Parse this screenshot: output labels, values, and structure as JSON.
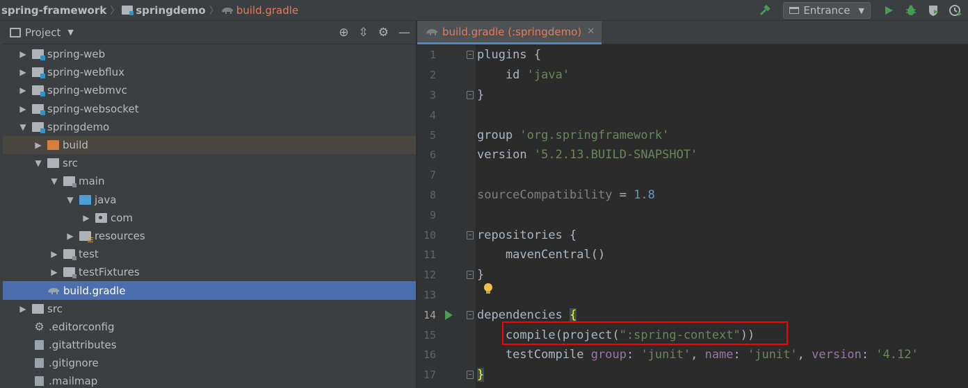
{
  "breadcrumbs": [
    "spring-framework",
    "springdemo",
    "build.gradle"
  ],
  "toolbar": {
    "run_config": "Entrance",
    "build_icon": "hammer-icon",
    "run_icon": "run-icon",
    "debug_icon": "debug-icon",
    "coverage_icon": "coverage-icon",
    "profile_icon": "profile-icon"
  },
  "project_panel": {
    "title": "Project",
    "tree": [
      {
        "label": "spring-web",
        "depth": 0,
        "expanded": false,
        "icon": "module-folder-icon"
      },
      {
        "label": "spring-webflux",
        "depth": 0,
        "expanded": false,
        "icon": "module-folder-icon"
      },
      {
        "label": "spring-webmvc",
        "depth": 0,
        "expanded": false,
        "icon": "module-folder-icon"
      },
      {
        "label": "spring-websocket",
        "depth": 0,
        "expanded": false,
        "icon": "module-folder-icon"
      },
      {
        "label": "springdemo",
        "depth": 0,
        "expanded": true,
        "icon": "module-folder-icon"
      },
      {
        "label": "build",
        "depth": 1,
        "expanded": false,
        "icon": "excluded-folder-icon"
      },
      {
        "label": "src",
        "depth": 1,
        "expanded": true,
        "icon": "folder-icon"
      },
      {
        "label": "main",
        "depth": 2,
        "expanded": true,
        "icon": "source-set-folder-icon"
      },
      {
        "label": "java",
        "depth": 3,
        "expanded": true,
        "icon": "source-root-icon"
      },
      {
        "label": "com",
        "depth": 4,
        "expanded": false,
        "icon": "package-icon"
      },
      {
        "label": "resources",
        "depth": 3,
        "expanded": false,
        "icon": "resources-folder-icon"
      },
      {
        "label": "test",
        "depth": 2,
        "expanded": false,
        "icon": "source-set-folder-icon"
      },
      {
        "label": "testFixtures",
        "depth": 2,
        "expanded": false,
        "icon": "source-set-folder-icon"
      },
      {
        "label": "build.gradle",
        "depth": 1,
        "expanded": null,
        "icon": "gradle-file-icon"
      },
      {
        "label": "src",
        "depth": 0,
        "expanded": false,
        "icon": "folder-icon"
      },
      {
        "label": ".editorconfig",
        "depth": 0,
        "expanded": null,
        "icon": "gear-icon"
      },
      {
        "label": ".gitattributes",
        "depth": 0,
        "expanded": null,
        "icon": "file-icon"
      },
      {
        "label": ".gitignore",
        "depth": 0,
        "expanded": null,
        "icon": "file-icon"
      },
      {
        "label": ".mailmap",
        "depth": 0,
        "expanded": null,
        "icon": "file-icon"
      }
    ]
  },
  "editor": {
    "tab_label": "build.gradle (:springdemo)",
    "current_line": 14,
    "lines": [
      {
        "n": "1",
        "parts": [
          [
            "plugins {",
            "kw"
          ]
        ]
      },
      {
        "n": "2",
        "parts": [
          [
            "    id ",
            "kw"
          ],
          [
            "'java'",
            "str"
          ]
        ]
      },
      {
        "n": "3",
        "parts": [
          [
            "}",
            "kw"
          ]
        ]
      },
      {
        "n": "4",
        "parts": []
      },
      {
        "n": "5",
        "parts": [
          [
            "group ",
            "kw"
          ],
          [
            "'org.springframework'",
            "str"
          ]
        ]
      },
      {
        "n": "6",
        "parts": [
          [
            "version ",
            "kw"
          ],
          [
            "'5.2.13.BUILD-SNAPSHOT'",
            "str"
          ]
        ]
      },
      {
        "n": "7",
        "parts": []
      },
      {
        "n": "8",
        "parts": [
          [
            "sourceCompatibility",
            "dim"
          ],
          [
            " = ",
            "kw"
          ],
          [
            "1.8",
            "num-lit"
          ]
        ]
      },
      {
        "n": "9",
        "parts": []
      },
      {
        "n": "10",
        "parts": [
          [
            "repositories {",
            "kw"
          ]
        ]
      },
      {
        "n": "11",
        "parts": [
          [
            "    mavenCentral()",
            "kw"
          ]
        ]
      },
      {
        "n": "12",
        "parts": [
          [
            "}",
            "kw"
          ]
        ]
      },
      {
        "n": "13",
        "parts": []
      },
      {
        "n": "14",
        "parts": [
          [
            "dependencies ",
            "kw"
          ],
          [
            "{",
            "brace-hl"
          ]
        ]
      },
      {
        "n": "15",
        "parts": [
          [
            "    compile(project(",
            "kw"
          ],
          [
            "\":spring-context\"",
            "str"
          ],
          [
            "))",
            "kw"
          ]
        ]
      },
      {
        "n": "16",
        "parts": [
          [
            "    testCompile ",
            "kw"
          ],
          [
            "group",
            "named-key"
          ],
          [
            ": ",
            "kw"
          ],
          [
            "'junit'",
            "str"
          ],
          [
            ", ",
            "kw"
          ],
          [
            "name",
            "named-key"
          ],
          [
            ": ",
            "kw"
          ],
          [
            "'junit'",
            "str"
          ],
          [
            ", ",
            "kw"
          ],
          [
            "version",
            "named-key"
          ],
          [
            ": ",
            "kw"
          ],
          [
            "'4.12'",
            "str"
          ]
        ]
      },
      {
        "n": "17",
        "parts": [
          [
            "}",
            "brace-hl"
          ]
        ]
      }
    ]
  },
  "colors": {
    "accent_tab_underline": "#4a88c7",
    "selection": "#4b6eaf",
    "annotation_box": "#ff0000",
    "string": "#6a8759",
    "gradle_file": "#e5795c"
  }
}
